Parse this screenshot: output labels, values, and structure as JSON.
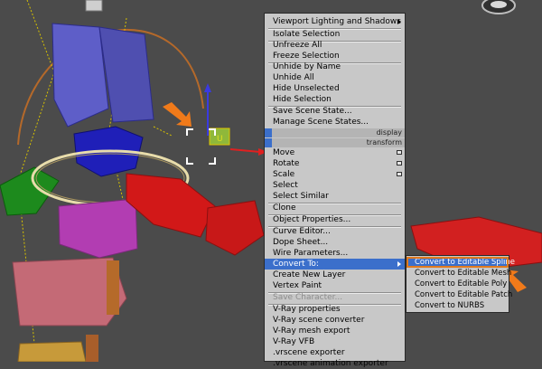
{
  "quad_menu": {
    "items": [
      {
        "label": "Viewport Lighting and Shadows",
        "submenu": true
      },
      {
        "label": "Isolate Selection"
      },
      {
        "label": "Unfreeze All"
      },
      {
        "label": "Freeze Selection"
      },
      {
        "label": "Unhide by Name"
      },
      {
        "label": "Unhide All"
      },
      {
        "label": "Hide Unselected"
      },
      {
        "label": "Hide Selection"
      },
      {
        "label": "Save Scene State..."
      },
      {
        "label": "Manage Scene States..."
      },
      {
        "label": "Move",
        "options": true
      },
      {
        "label": "Rotate",
        "options": true
      },
      {
        "label": "Scale",
        "options": true
      },
      {
        "label": "Select"
      },
      {
        "label": "Select Similar"
      },
      {
        "label": "Clone"
      },
      {
        "label": "Object Properties..."
      },
      {
        "label": "Curve Editor..."
      },
      {
        "label": "Dope Sheet..."
      },
      {
        "label": "Wire Parameters..."
      },
      {
        "label": "Convert To:",
        "submenu": true,
        "highlighted": true
      },
      {
        "label": "Create New Layer"
      },
      {
        "label": "Vertex Paint"
      },
      {
        "label": "Save Character...",
        "disabled": true
      },
      {
        "label": "V-Ray properties"
      },
      {
        "label": "V-Ray scene converter"
      },
      {
        "label": "V-Ray mesh export"
      },
      {
        "label": "V-Ray VFB"
      },
      {
        "label": ".vrscene exporter"
      },
      {
        "label": ".vrscene animation exporter"
      }
    ],
    "quadrant_labels": {
      "display": "display",
      "transform": "transform"
    }
  },
  "convert_submenu": {
    "items": [
      {
        "label": "Convert to Editable Spline",
        "highlighted": true
      },
      {
        "label": "Convert to Editable Mesh"
      },
      {
        "label": "Convert to Editable Poly"
      },
      {
        "label": "Convert to Editable Patch"
      },
      {
        "label": "Convert to NURBS"
      }
    ]
  },
  "colors": {
    "menu_bg": "#c8c8c8",
    "highlight": "#3b6fcb",
    "callout_arrow": "#f07a1a",
    "viewport_bg": "#4b4b4b"
  },
  "icons": [
    "selection-bracket-icon",
    "callout-arrow-icon",
    "camera-icon"
  ]
}
